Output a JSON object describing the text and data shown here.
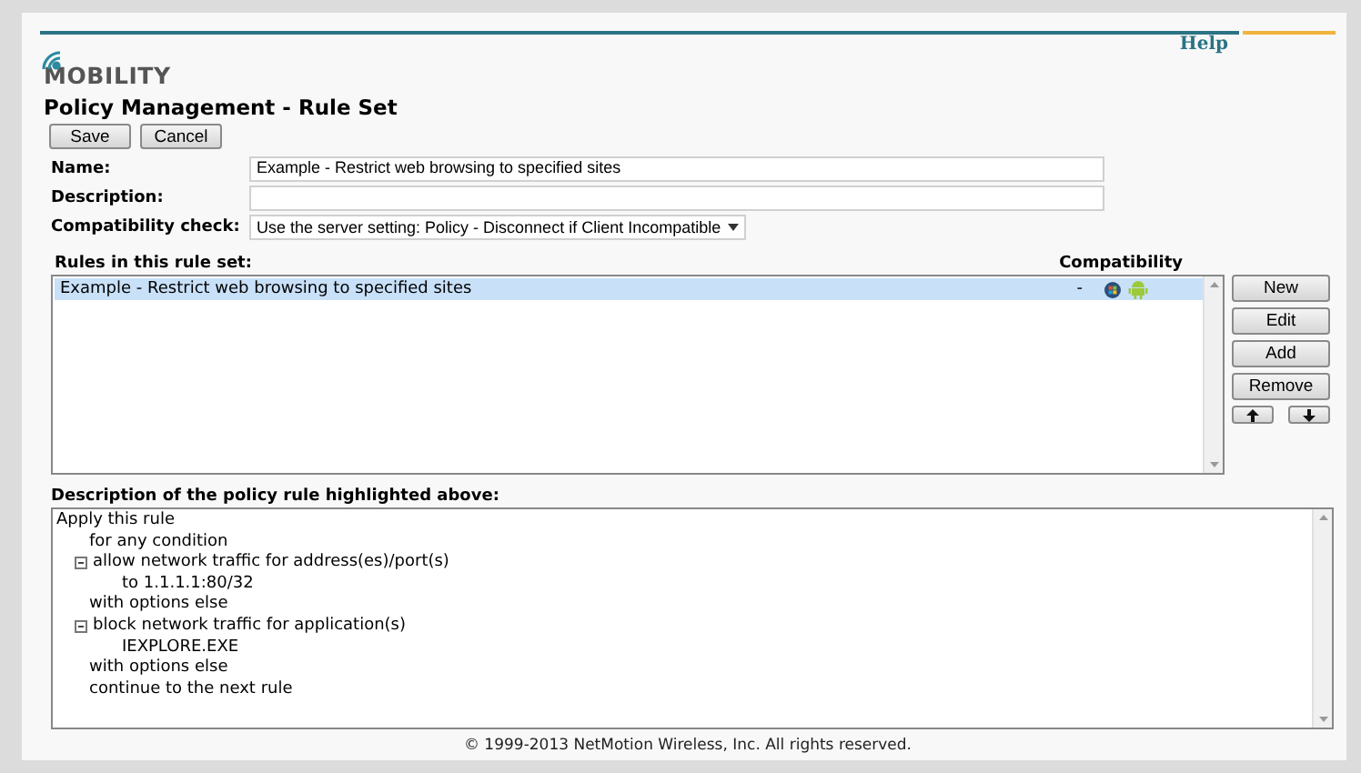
{
  "header": {
    "logo": "MOBILITY",
    "help_link": "Help"
  },
  "title": "Policy Management - Rule Set",
  "actions": [
    "Save",
    "Cancel"
  ],
  "form": [
    {
      "label": "Name:",
      "kind": "text",
      "value": "Example - Restrict web browsing to specified sites"
    },
    {
      "label": "Description:",
      "kind": "text"
    },
    {
      "label": "Compatibility check:",
      "kind": "select",
      "value": "Use the server setting: Policy - Disconnect if Client Incompatible"
    }
  ],
  "rules": {
    "heading": "Rules in this rule set:",
    "compat_heading": "Compatibility",
    "rows": [
      {
        "name": "Example - Restrict web browsing to specified sites",
        "marker": "-",
        "selected": true
      }
    ],
    "buttons": [
      "New",
      "Edit",
      "Add",
      "Remove"
    ]
  },
  "description": {
    "heading": "Description of the policy rule highlighted above:",
    "tree": [
      {
        "text": "Apply this rule",
        "children": [
          {
            "text": "for any condition"
          },
          {
            "text": "allow network traffic for address(es)/port(s)",
            "expanded": true,
            "children": [
              {
                "text": "to 1.1.1.1:80/32"
              }
            ]
          },
          {
            "text": "with options else"
          },
          {
            "text": "block network traffic for application(s)",
            "expanded": true,
            "children": [
              {
                "text": "IEXPLORE.EXE"
              }
            ]
          },
          {
            "text": "with options else"
          },
          {
            "text": "continue to the next rule"
          }
        ]
      }
    ]
  },
  "footer": "© 1999-2013 NetMotion Wireless, Inc. All rights reserved."
}
